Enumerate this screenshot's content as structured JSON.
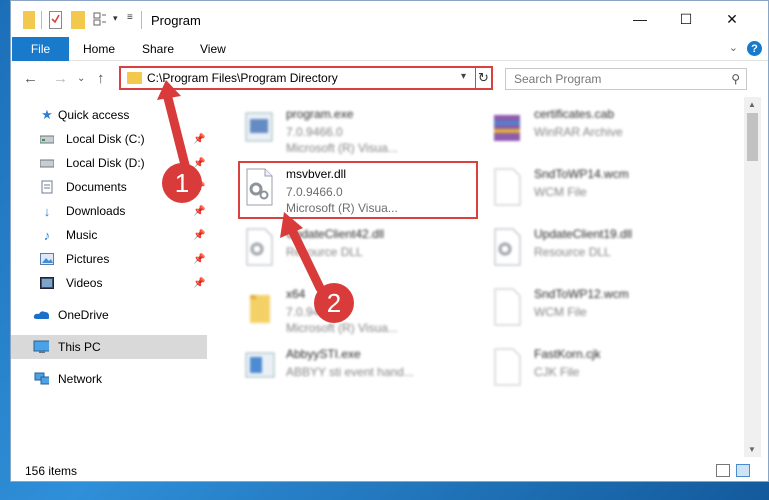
{
  "window": {
    "title": "Program",
    "controls": {
      "minimize": "—",
      "maximize": "☐",
      "close": "✕"
    }
  },
  "ribbon": {
    "file": "File",
    "tabs": [
      "Home",
      "Share",
      "View"
    ],
    "help": "?"
  },
  "address": {
    "path": "C:\\Program Files\\Program Directory"
  },
  "search": {
    "placeholder": "Search Program"
  },
  "sidebar": {
    "items": [
      {
        "label": "Quick access",
        "icon": "star-icon",
        "pinned": false
      },
      {
        "label": "Local Disk (C:)",
        "icon": "drive-icon",
        "pinned": true
      },
      {
        "label": "Local Disk (D:)",
        "icon": "drive-icon",
        "pinned": true
      },
      {
        "label": "Documents",
        "icon": "documents-icon",
        "pinned": true
      },
      {
        "label": "Downloads",
        "icon": "download-icon",
        "pinned": true
      },
      {
        "label": "Music",
        "icon": "music-icon",
        "pinned": true
      },
      {
        "label": "Pictures",
        "icon": "pictures-icon",
        "pinned": true
      },
      {
        "label": "Videos",
        "icon": "videos-icon",
        "pinned": true
      },
      {
        "label": "OneDrive",
        "icon": "cloud-icon",
        "pinned": false
      },
      {
        "label": "This PC",
        "icon": "computer-icon",
        "pinned": false,
        "selected": true
      },
      {
        "label": "Network",
        "icon": "network-icon",
        "pinned": false
      }
    ]
  },
  "files": [
    {
      "name": "program.exe",
      "line1": "7.0.9466.0",
      "line2": "Microsoft (R) Visua...",
      "icon": "exe-icon"
    },
    {
      "name": "certificates.cab",
      "line1": "WinRAR Archive",
      "line2": "",
      "icon": "archive-icon"
    },
    {
      "name": "msvbver.dll",
      "line1": "7.0.9466.0",
      "line2": "Microsoft (R) Visua...",
      "icon": "dll-gear-icon"
    },
    {
      "name": "SndToWP14.wcm",
      "line1": "WCM File",
      "line2": "",
      "icon": "blank-file-icon"
    },
    {
      "name": "UpdateClient42.dll",
      "line1": "Resource DLL",
      "line2": "",
      "icon": "dll-gear-icon"
    },
    {
      "name": "UpdateClient19.dll",
      "line1": "Resource DLL",
      "line2": "",
      "icon": "dll-gear-icon"
    },
    {
      "name": "x64",
      "line1": "7.0.9466.0",
      "line2": "Microsoft (R) Visua...",
      "icon": "folder-icon"
    },
    {
      "name": "SndToWP12.wcm",
      "line1": "WCM File",
      "line2": "",
      "icon": "blank-file-icon"
    },
    {
      "name": "AbbyySTI.exe",
      "line1": "ABBYY sti event hand...",
      "line2": "",
      "icon": "exe-icon"
    },
    {
      "name": "FastKorn.cjk",
      "line1": "CJK File",
      "line2": "",
      "icon": "blank-file-icon"
    }
  ],
  "status": {
    "items": "156 items"
  },
  "annotations": [
    "1",
    "2"
  ],
  "colors": {
    "accent": "#1979ca",
    "annotation": "#d93b3b",
    "selection": "#d9d9d9"
  }
}
